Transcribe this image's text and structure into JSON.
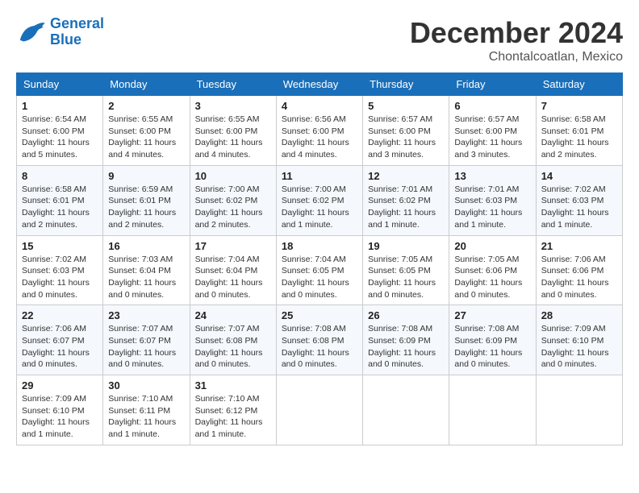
{
  "header": {
    "logo": {
      "line1": "General",
      "line2": "Blue"
    },
    "title": "December 2024",
    "location": "Chontalcoatlan, Mexico"
  },
  "days_of_week": [
    "Sunday",
    "Monday",
    "Tuesday",
    "Wednesday",
    "Thursday",
    "Friday",
    "Saturday"
  ],
  "weeks": [
    [
      {
        "day": "1",
        "info": "Sunrise: 6:54 AM\nSunset: 6:00 PM\nDaylight: 11 hours\nand 5 minutes."
      },
      {
        "day": "2",
        "info": "Sunrise: 6:55 AM\nSunset: 6:00 PM\nDaylight: 11 hours\nand 4 minutes."
      },
      {
        "day": "3",
        "info": "Sunrise: 6:55 AM\nSunset: 6:00 PM\nDaylight: 11 hours\nand 4 minutes."
      },
      {
        "day": "4",
        "info": "Sunrise: 6:56 AM\nSunset: 6:00 PM\nDaylight: 11 hours\nand 4 minutes."
      },
      {
        "day": "5",
        "info": "Sunrise: 6:57 AM\nSunset: 6:00 PM\nDaylight: 11 hours\nand 3 minutes."
      },
      {
        "day": "6",
        "info": "Sunrise: 6:57 AM\nSunset: 6:00 PM\nDaylight: 11 hours\nand 3 minutes."
      },
      {
        "day": "7",
        "info": "Sunrise: 6:58 AM\nSunset: 6:01 PM\nDaylight: 11 hours\nand 2 minutes."
      }
    ],
    [
      {
        "day": "8",
        "info": "Sunrise: 6:58 AM\nSunset: 6:01 PM\nDaylight: 11 hours\nand 2 minutes."
      },
      {
        "day": "9",
        "info": "Sunrise: 6:59 AM\nSunset: 6:01 PM\nDaylight: 11 hours\nand 2 minutes."
      },
      {
        "day": "10",
        "info": "Sunrise: 7:00 AM\nSunset: 6:02 PM\nDaylight: 11 hours\nand 2 minutes."
      },
      {
        "day": "11",
        "info": "Sunrise: 7:00 AM\nSunset: 6:02 PM\nDaylight: 11 hours\nand 1 minute."
      },
      {
        "day": "12",
        "info": "Sunrise: 7:01 AM\nSunset: 6:02 PM\nDaylight: 11 hours\nand 1 minute."
      },
      {
        "day": "13",
        "info": "Sunrise: 7:01 AM\nSunset: 6:03 PM\nDaylight: 11 hours\nand 1 minute."
      },
      {
        "day": "14",
        "info": "Sunrise: 7:02 AM\nSunset: 6:03 PM\nDaylight: 11 hours\nand 1 minute."
      }
    ],
    [
      {
        "day": "15",
        "info": "Sunrise: 7:02 AM\nSunset: 6:03 PM\nDaylight: 11 hours\nand 0 minutes."
      },
      {
        "day": "16",
        "info": "Sunrise: 7:03 AM\nSunset: 6:04 PM\nDaylight: 11 hours\nand 0 minutes."
      },
      {
        "day": "17",
        "info": "Sunrise: 7:04 AM\nSunset: 6:04 PM\nDaylight: 11 hours\nand 0 minutes."
      },
      {
        "day": "18",
        "info": "Sunrise: 7:04 AM\nSunset: 6:05 PM\nDaylight: 11 hours\nand 0 minutes."
      },
      {
        "day": "19",
        "info": "Sunrise: 7:05 AM\nSunset: 6:05 PM\nDaylight: 11 hours\nand 0 minutes."
      },
      {
        "day": "20",
        "info": "Sunrise: 7:05 AM\nSunset: 6:06 PM\nDaylight: 11 hours\nand 0 minutes."
      },
      {
        "day": "21",
        "info": "Sunrise: 7:06 AM\nSunset: 6:06 PM\nDaylight: 11 hours\nand 0 minutes."
      }
    ],
    [
      {
        "day": "22",
        "info": "Sunrise: 7:06 AM\nSunset: 6:07 PM\nDaylight: 11 hours\nand 0 minutes."
      },
      {
        "day": "23",
        "info": "Sunrise: 7:07 AM\nSunset: 6:07 PM\nDaylight: 11 hours\nand 0 minutes."
      },
      {
        "day": "24",
        "info": "Sunrise: 7:07 AM\nSunset: 6:08 PM\nDaylight: 11 hours\nand 0 minutes."
      },
      {
        "day": "25",
        "info": "Sunrise: 7:08 AM\nSunset: 6:08 PM\nDaylight: 11 hours\nand 0 minutes."
      },
      {
        "day": "26",
        "info": "Sunrise: 7:08 AM\nSunset: 6:09 PM\nDaylight: 11 hours\nand 0 minutes."
      },
      {
        "day": "27",
        "info": "Sunrise: 7:08 AM\nSunset: 6:09 PM\nDaylight: 11 hours\nand 0 minutes."
      },
      {
        "day": "28",
        "info": "Sunrise: 7:09 AM\nSunset: 6:10 PM\nDaylight: 11 hours\nand 0 minutes."
      }
    ],
    [
      {
        "day": "29",
        "info": "Sunrise: 7:09 AM\nSunset: 6:10 PM\nDaylight: 11 hours\nand 1 minute."
      },
      {
        "day": "30",
        "info": "Sunrise: 7:10 AM\nSunset: 6:11 PM\nDaylight: 11 hours\nand 1 minute."
      },
      {
        "day": "31",
        "info": "Sunrise: 7:10 AM\nSunset: 6:12 PM\nDaylight: 11 hours\nand 1 minute."
      },
      {
        "day": "",
        "info": ""
      },
      {
        "day": "",
        "info": ""
      },
      {
        "day": "",
        "info": ""
      },
      {
        "day": "",
        "info": ""
      }
    ]
  ]
}
